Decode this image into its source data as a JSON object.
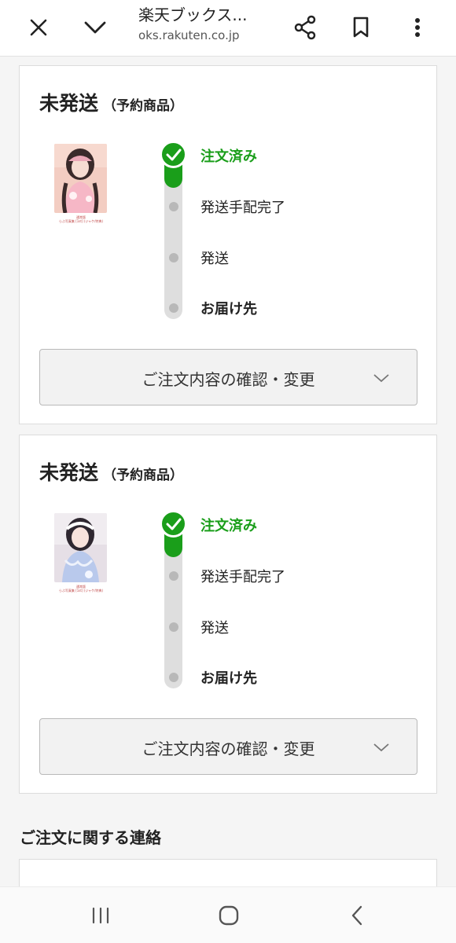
{
  "browser": {
    "title": "楽天ブックス...",
    "url": "oks.rakuten.co.jp"
  },
  "orders": [
    {
      "status": "未発送",
      "status_note": "（予約商品）",
      "thumbnail_caption_line1": "通常版",
      "thumbnail_caption_line2": "らぶ写真集 [1st] (ジャケ/特典)",
      "steps": [
        {
          "label": "注文済み",
          "state": "done"
        },
        {
          "label": "発送手配完了",
          "state": "pending"
        },
        {
          "label": "発送",
          "state": "pending"
        },
        {
          "label": "お届け先",
          "state": "pending"
        }
      ],
      "confirm_label": "ご注文内容の確認・変更"
    },
    {
      "status": "未発送",
      "status_note": "（予約商品）",
      "thumbnail_caption_line1": "通常版",
      "thumbnail_caption_line2": "らぶ写真集 [1st] (ジャケ/特典)",
      "steps": [
        {
          "label": "注文済み",
          "state": "done"
        },
        {
          "label": "発送手配完了",
          "state": "pending"
        },
        {
          "label": "発送",
          "state": "pending"
        },
        {
          "label": "お届け先",
          "state": "pending"
        }
      ],
      "confirm_label": "ご注文内容の確認・変更"
    }
  ],
  "contact_section": {
    "heading": "ご注文に関する連絡"
  },
  "colors": {
    "accent_green": "#1a9e1a",
    "progress_track": "#dedede",
    "caption_red": "#c04848"
  },
  "icons": {
    "close": "close-icon",
    "collapse": "chevron-down-icon",
    "share": "share-icon",
    "bookmark": "bookmark-icon",
    "menu": "more-vert-icon",
    "step_done": "checkmark-icon",
    "confirm_expand": "chevron-down-icon",
    "nav_recents": "recent-apps-icon",
    "nav_home": "home-icon",
    "nav_back": "back-icon"
  }
}
